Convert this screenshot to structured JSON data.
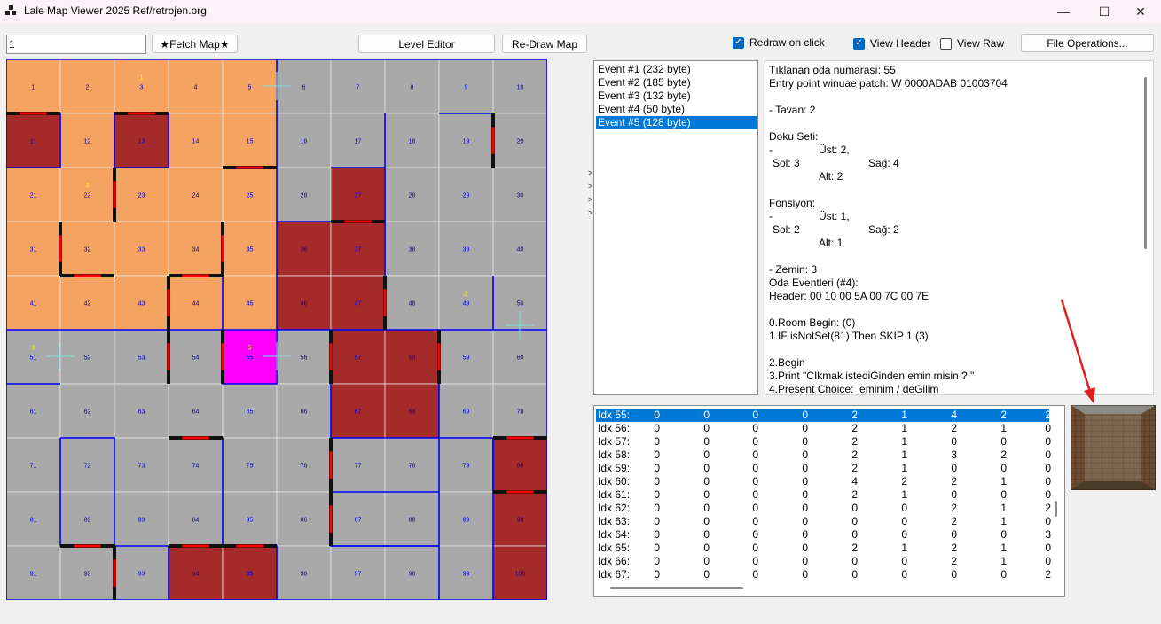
{
  "window": {
    "title": "Lale Map Viewer 2025 Ref/retrojen.org",
    "minimize_glyph": "—",
    "maximize_glyph": "☐",
    "close_glyph": "✕"
  },
  "toolbar": {
    "map_number_value": "1",
    "fetch_label": "★Fetch Map★",
    "level_editor_label": "Level Editor",
    "redraw_label": "Re-Draw Map",
    "redraw_on_click_label": "Redraw on click",
    "redraw_on_click_checked": true,
    "view_header_label": "View Header",
    "view_header_checked": true,
    "view_raw_label": "View Raw",
    "view_raw_checked": false,
    "file_ops_label": "File Operations..."
  },
  "map": {
    "rooms": [
      "1",
      "2",
      "3",
      "4",
      "5",
      "6",
      "7",
      "8",
      "9",
      "10",
      "11",
      "12",
      "13",
      "14",
      "15",
      "16",
      "17",
      "18",
      "19",
      "20",
      "21",
      "22",
      "23",
      "24",
      "25",
      "26",
      "27",
      "28",
      "29",
      "30",
      "31",
      "32",
      "33",
      "34",
      "35",
      "36",
      "37",
      "38",
      "39",
      "40",
      "41",
      "42",
      "43",
      "44",
      "45",
      "46",
      "47",
      "48",
      "49",
      "50",
      "51",
      "52",
      "53",
      "54",
      "55",
      "56",
      "57",
      "58",
      "59",
      "60",
      "61",
      "62",
      "63",
      "64",
      "65",
      "66",
      "67",
      "68",
      "69",
      "70",
      "71",
      "72",
      "73",
      "74",
      "75",
      "76",
      "77",
      "78",
      "79",
      "80",
      "81",
      "82",
      "83",
      "84",
      "85",
      "86",
      "87",
      "88",
      "89",
      "90",
      "91",
      "92",
      "93",
      "94",
      "95",
      "96",
      "97",
      "98",
      "99",
      "100"
    ],
    "orange_rooms": [
      1,
      2,
      3,
      4,
      5,
      11,
      12,
      13,
      14,
      15,
      21,
      22,
      23,
      24,
      25,
      31,
      32,
      33,
      34,
      35,
      41,
      42,
      43,
      44,
      45
    ],
    "dark_red_rooms": [
      11,
      13,
      27,
      36,
      37,
      46,
      47,
      57,
      58,
      67,
      68,
      80,
      90,
      94,
      95,
      100
    ],
    "selected_room": 55,
    "event_markers": [
      {
        "room": 3,
        "label": "1"
      },
      {
        "room": 22,
        "label": "4"
      },
      {
        "room": 49,
        "label": "2"
      },
      {
        "room": 51,
        "label": "3"
      },
      {
        "room": 55,
        "label": "5"
      }
    ],
    "colors": {
      "orange": "#f4a460",
      "dark_red": "#a52a2a",
      "gray": "#a9a9a9",
      "selected": "#ff00ff",
      "wall": "#0000ff",
      "door": "#ff0000",
      "marker": "#ffff00"
    }
  },
  "events": {
    "items": [
      "Event #1 (232 byte)",
      "Event #2 (185 byte)",
      "Event #3 (132 byte)",
      "Event #4 (50 byte)",
      "Event #5 (128 byte)"
    ],
    "selected_index": 4,
    "expand_glyph": ">"
  },
  "detail": {
    "l01": "Tıklanan oda numarası: 55",
    "l02": "Entry point winuae patch: W 0000ADAB 01003704",
    "l04": "- Tavan: 2",
    "l06": "Doku Seti:",
    "l07": "-",
    "l07b": "Üst: 2,",
    "l08": "Sol: 3",
    "l08b": "Sağ: 4",
    "l09": "Alt: 2",
    "l11": "Fonsiyon:",
    "l12": "-",
    "l12b": "Üst: 1,",
    "l13": "Sol: 2",
    "l13b": "Sağ: 2",
    "l14": "Alt: 1",
    "l16": "- Zemin: 3",
    "l17": "Oda Eventleri (#4):",
    "l18": "Header: 00 10 00 5A 00 7C 00 7E",
    "l20": "0.Room Begin: (0)",
    "l21": "1.IF isNotSet(81) Then SKIP 1 (3)",
    "l23": "2.Begin",
    "l24": "3.Print \"CIkmak istediGinden emin misin ? \"",
    "l25": "4.Present Choice:  eminim / deGilim"
  },
  "index_table": {
    "selected_index": 0,
    "rows": [
      {
        "label": "Idx 55:",
        "cells": [
          "0",
          "0",
          "0",
          "0",
          "2",
          "1",
          "4",
          "2",
          "2"
        ]
      },
      {
        "label": "Idx 56:",
        "cells": [
          "0",
          "0",
          "0",
          "0",
          "2",
          "1",
          "2",
          "1",
          "0"
        ]
      },
      {
        "label": "Idx 57:",
        "cells": [
          "0",
          "0",
          "0",
          "0",
          "2",
          "1",
          "0",
          "0",
          "0"
        ]
      },
      {
        "label": "Idx 58:",
        "cells": [
          "0",
          "0",
          "0",
          "0",
          "2",
          "1",
          "3",
          "2",
          "0"
        ]
      },
      {
        "label": "Idx 59:",
        "cells": [
          "0",
          "0",
          "0",
          "0",
          "2",
          "1",
          "0",
          "0",
          "0"
        ]
      },
      {
        "label": "Idx 60:",
        "cells": [
          "0",
          "0",
          "0",
          "0",
          "4",
          "2",
          "2",
          "1",
          "0"
        ]
      },
      {
        "label": "Idx 61:",
        "cells": [
          "0",
          "0",
          "0",
          "0",
          "2",
          "1",
          "0",
          "0",
          "0"
        ]
      },
      {
        "label": "Idx 62:",
        "cells": [
          "0",
          "0",
          "0",
          "0",
          "0",
          "0",
          "2",
          "1",
          "2"
        ]
      },
      {
        "label": "Idx 63:",
        "cells": [
          "0",
          "0",
          "0",
          "0",
          "0",
          "0",
          "2",
          "1",
          "0"
        ]
      },
      {
        "label": "Idx 64:",
        "cells": [
          "0",
          "0",
          "0",
          "0",
          "0",
          "0",
          "0",
          "0",
          "3"
        ]
      },
      {
        "label": "Idx 65:",
        "cells": [
          "0",
          "0",
          "0",
          "0",
          "2",
          "1",
          "2",
          "1",
          "0"
        ]
      },
      {
        "label": "Idx 66:",
        "cells": [
          "0",
          "0",
          "0",
          "0",
          "0",
          "0",
          "2",
          "1",
          "0"
        ]
      },
      {
        "label": "Idx 67:",
        "cells": [
          "0",
          "0",
          "0",
          "0",
          "0",
          "0",
          "0",
          "0",
          "2"
        ]
      }
    ]
  },
  "annotation_color": "#e02020"
}
